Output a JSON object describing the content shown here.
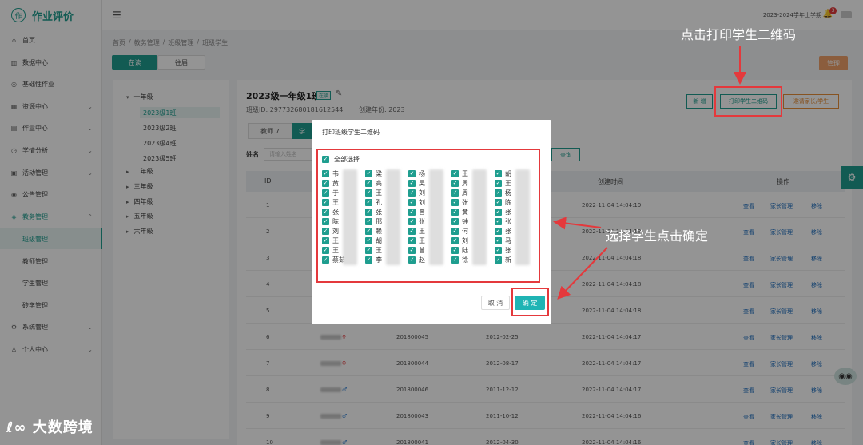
{
  "app": {
    "title": "作业评价",
    "logo_glyph": "作"
  },
  "topbar": {
    "term": "2023-2024学年上学期",
    "notify_count": "3"
  },
  "sidebar": {
    "items": [
      {
        "icon": "home-icon",
        "glyph": "⌂",
        "label": "首页"
      },
      {
        "icon": "chart-icon",
        "glyph": "▥",
        "label": "数据中心"
      },
      {
        "icon": "book-icon",
        "glyph": "◎",
        "label": "基础性作业"
      },
      {
        "icon": "grid-icon",
        "glyph": "▦",
        "label": "资源中心"
      },
      {
        "icon": "homework-icon",
        "glyph": "▤",
        "label": "作业中心"
      },
      {
        "icon": "analysis-icon",
        "glyph": "◷",
        "label": "学情分析"
      },
      {
        "icon": "activity-icon",
        "glyph": "▣",
        "label": "活动管理"
      },
      {
        "icon": "notice-icon",
        "glyph": "◉",
        "label": "公告管理"
      },
      {
        "icon": "affairs-icon",
        "glyph": "◈",
        "label": "教务管理"
      },
      {
        "icon": "settings-icon",
        "glyph": "⚙",
        "label": "系统管理"
      },
      {
        "icon": "user-icon",
        "glyph": "♙",
        "label": "个人中心"
      }
    ],
    "sub_items": [
      "班级管理",
      "教师管理",
      "学生管理",
      "砖学管理"
    ]
  },
  "breadcrumb": [
    "首页",
    "/",
    "教务管理",
    "/",
    "班级管理",
    "/",
    "班级学生"
  ],
  "tabs": {
    "current": "在读",
    "past": "往届"
  },
  "manage_btn": "管理",
  "tree": {
    "grade1": "一年级",
    "classes": [
      "2023级1班",
      "2023级2班",
      "2023级4班",
      "2023级5班"
    ],
    "others": [
      "二年级",
      "三年级",
      "四年级",
      "五年级",
      "六年级"
    ]
  },
  "class_info": {
    "title": "2023级一年级1班",
    "tag": "在读",
    "class_id": "班级ID: 297732680181612544",
    "year": "创建年份: 2023"
  },
  "subtabs": {
    "teacher": "教师 7",
    "student": "学"
  },
  "filter": {
    "name_label": "姓名",
    "name_placeholder": "请输入姓名",
    "search": "查询"
  },
  "actions": {
    "new": "新 增",
    "print_qr": "打印学生二维码",
    "invite": "邀请家长/学生"
  },
  "table": {
    "headers": [
      "ID",
      "创建时间",
      "操作"
    ],
    "op_labels": [
      "查看",
      "家长管理",
      "移除"
    ],
    "rows": [
      {
        "id": "1",
        "student_no": "",
        "birthday": "",
        "created": "2022-11-04 14:04:19",
        "gender": ""
      },
      {
        "id": "2",
        "student_no": "",
        "birthday": "",
        "created": "2022-11-04 14:04:19",
        "gender": ""
      },
      {
        "id": "3",
        "student_no": "",
        "birthday": "",
        "created": "2022-11-04 14:04:18",
        "gender": ""
      },
      {
        "id": "4",
        "student_no": "",
        "birthday": "",
        "created": "2022-11-04 14:04:18",
        "gender": ""
      },
      {
        "id": "5",
        "student_no": "",
        "birthday": "",
        "created": "2022-11-04 14:04:18",
        "gender": ""
      },
      {
        "id": "6",
        "student_no": "201800045",
        "birthday": "2012-02-25",
        "created": "2022-11-04 14:04:17",
        "gender": "♀"
      },
      {
        "id": "7",
        "student_no": "201800044",
        "birthday": "2012-08-17",
        "created": "2022-11-04 14:04:17",
        "gender": "♀"
      },
      {
        "id": "8",
        "student_no": "201800046",
        "birthday": "2011-12-12",
        "created": "2022-11-04 14:04:17",
        "gender": "♂"
      },
      {
        "id": "9",
        "student_no": "201800043",
        "birthday": "2011-10-12",
        "created": "2022-11-04 14:04:16",
        "gender": "♂"
      },
      {
        "id": "10",
        "student_no": "201800041",
        "birthday": "2012-04-30",
        "created": "2022-11-04 14:04:16",
        "gender": "♂"
      }
    ]
  },
  "modal": {
    "title": "打印班级学生二维码",
    "select_all": "全部选择",
    "cancel": "取 消",
    "confirm": "确 定",
    "columns": [
      [
        "韦",
        "黄",
        "于",
        "王",
        "张",
        "陈",
        "刘",
        "王",
        "王",
        "蔡茹涵"
      ],
      [
        "梁",
        "高",
        "王",
        "孔",
        "张",
        "邢",
        "赖",
        "胡",
        "王",
        "李"
      ],
      [
        "杨",
        "吴",
        "刘",
        "刘",
        "曾",
        "张",
        "王",
        "王",
        "曾",
        "赵"
      ],
      [
        "王",
        "周",
        "周",
        "张",
        "黄",
        "钟",
        "何",
        "刘",
        "陆",
        "徐"
      ],
      [
        "胡",
        "王",
        "杨",
        "陈",
        "张",
        "张",
        "张",
        "马",
        "张",
        "新"
      ]
    ]
  },
  "annotations": {
    "top": "点击打印学生二维码",
    "right": "选择学生点击确定"
  },
  "watermark": "大数跨境"
}
